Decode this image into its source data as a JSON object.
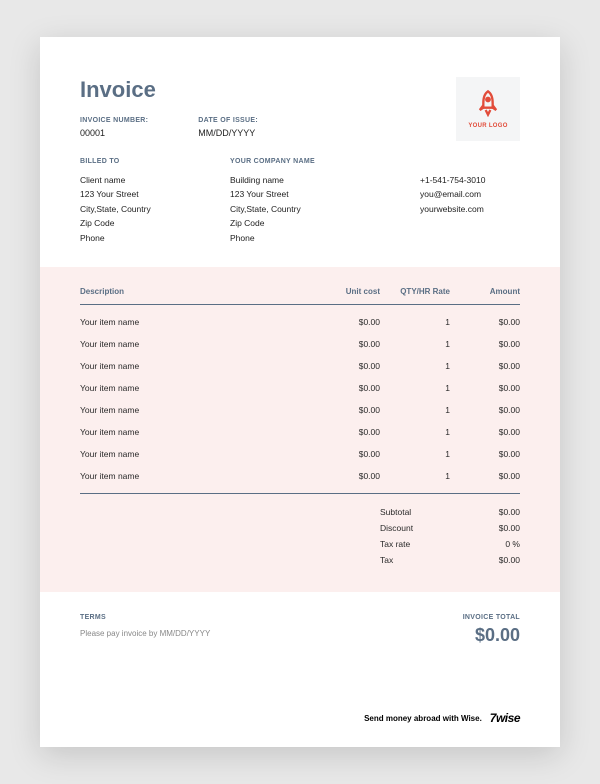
{
  "title": "Invoice",
  "invoiceNumber": {
    "label": "INVOICE NUMBER:",
    "value": "00001"
  },
  "dateOfIssue": {
    "label": "DATE OF ISSUE:",
    "value": "MM/DD/YYYY"
  },
  "logo": {
    "text": "YOUR LOGO"
  },
  "billedTo": {
    "label": "BILLED TO",
    "lines": [
      "Client name",
      "123 Your Street",
      "City,State, Country",
      "Zip Code",
      "Phone"
    ]
  },
  "company": {
    "label": "YOUR COMPANY NAME",
    "lines": [
      "Building name",
      "123 Your Street",
      "City,State, Country",
      "Zip Code",
      "Phone"
    ]
  },
  "contact": {
    "lines": [
      "+1-541-754-3010",
      "you@email.com",
      "yourwebsite.com"
    ]
  },
  "columns": {
    "desc": "Description",
    "unit": "Unit cost",
    "qty": "QTY/HR Rate",
    "amount": "Amount"
  },
  "items": [
    {
      "desc": "Your item name",
      "unit": "$0.00",
      "qty": "1",
      "amount": "$0.00"
    },
    {
      "desc": "Your item name",
      "unit": "$0.00",
      "qty": "1",
      "amount": "$0.00"
    },
    {
      "desc": "Your item name",
      "unit": "$0.00",
      "qty": "1",
      "amount": "$0.00"
    },
    {
      "desc": "Your item name",
      "unit": "$0.00",
      "qty": "1",
      "amount": "$0.00"
    },
    {
      "desc": "Your item name",
      "unit": "$0.00",
      "qty": "1",
      "amount": "$0.00"
    },
    {
      "desc": "Your item name",
      "unit": "$0.00",
      "qty": "1",
      "amount": "$0.00"
    },
    {
      "desc": "Your item name",
      "unit": "$0.00",
      "qty": "1",
      "amount": "$0.00"
    },
    {
      "desc": "Your item name",
      "unit": "$0.00",
      "qty": "1",
      "amount": "$0.00"
    }
  ],
  "totals": {
    "subtotal": {
      "label": "Subtotal",
      "value": "$0.00"
    },
    "discount": {
      "label": "Discount",
      "value": "$0.00"
    },
    "taxrate": {
      "label": "Tax rate",
      "value": "0 %"
    },
    "tax": {
      "label": "Tax",
      "value": "$0.00"
    }
  },
  "terms": {
    "label": "TERMS",
    "text": "Please pay invoice by MM/DD/YYYY"
  },
  "invoiceTotal": {
    "label": "INVOICE TOTAL",
    "value": "$0.00"
  },
  "wise": {
    "text": "Send money abroad with Wise.",
    "brand": "7wise"
  }
}
